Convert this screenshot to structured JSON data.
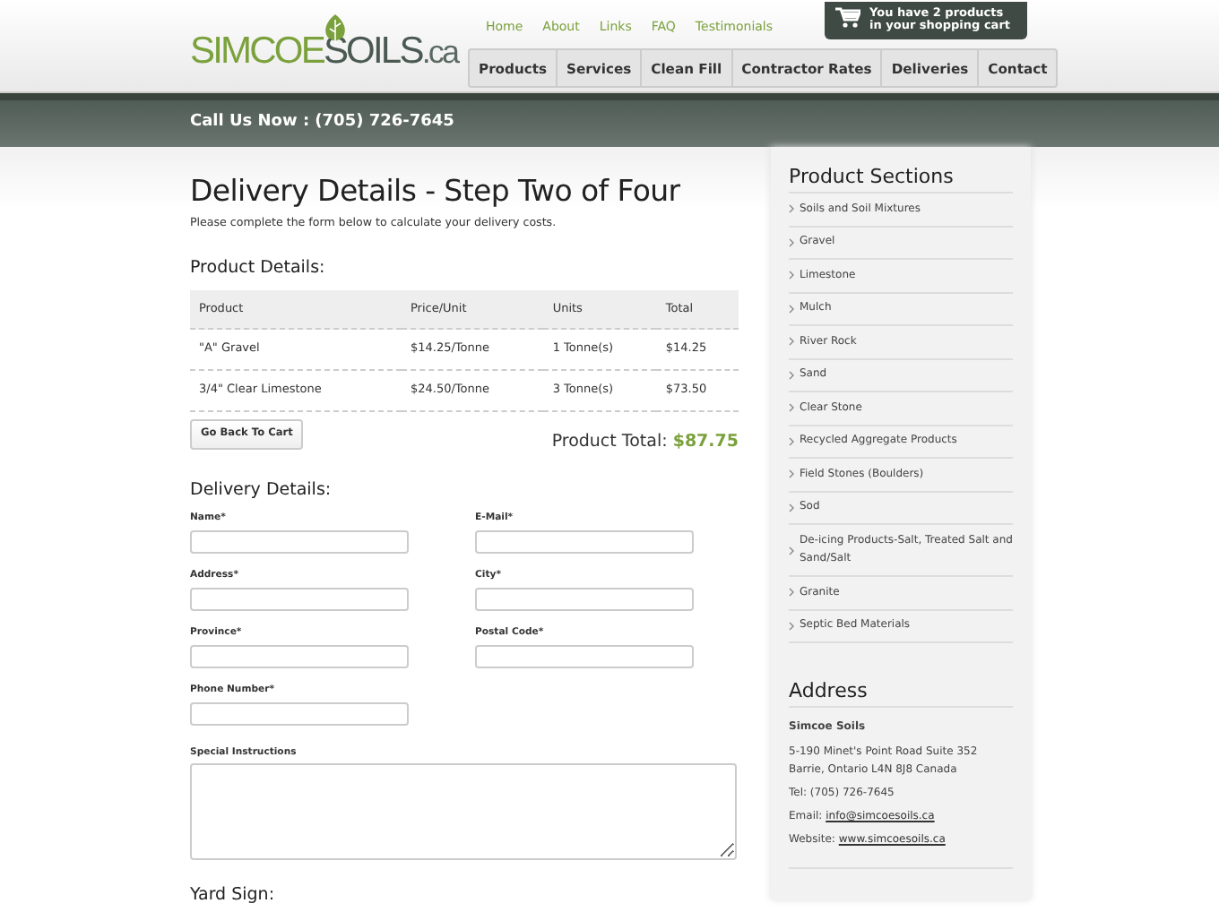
{
  "logo": [
    "SIMCOE",
    "SOILS",
    ".ca"
  ],
  "top_links": [
    "Home",
    "About",
    "Links",
    "FAQ",
    "Testimonials"
  ],
  "cart": [
    "You have 2 products",
    "in your shopping cart"
  ],
  "main_nav": [
    "Products",
    "Services",
    "Clean Fill",
    "Contractor Rates",
    "Deliveries",
    "Contact"
  ],
  "phone_bar": "Call Us Now : (705) 726-7645",
  "title": "Delivery Details - Step Two of Four",
  "intro": "Please complete the form below to calculate your delivery costs.",
  "product_details": {
    "heading": "Product Details:",
    "columns": [
      "Product",
      "Price/Unit",
      "Units",
      "Total"
    ],
    "rows": [
      [
        "\"A\" Gravel",
        "$14.25/Tonne",
        "1 Tonne(s)",
        "$14.25"
      ],
      [
        "3/4\" Clear Limestone",
        "$24.50/Tonne",
        "3 Tonne(s)",
        "$73.50"
      ]
    ],
    "back_button": "Go Back To Cart",
    "total_label": "Product Total:",
    "total_value": "$87.75"
  },
  "delivery_details": {
    "heading": "Delivery Details:",
    "fields": [
      {
        "label": "Name*"
      },
      {
        "label": "E-Mail*"
      },
      {
        "label": "Address*"
      },
      {
        "label": "City*"
      },
      {
        "label": "Province*"
      },
      {
        "label": "Postal Code*"
      },
      {
        "label": "Phone Number*"
      }
    ],
    "instructions_label": "Special Instructions"
  },
  "yard_sign": {
    "heading": "Yard Sign:"
  },
  "sidebar": {
    "heading": "Product Sections",
    "items": [
      "Soils and Soil Mixtures",
      "Gravel",
      "Limestone",
      "Mulch",
      "River Rock",
      "Sand",
      "Clear Stone",
      "Recycled Aggregate Products",
      "Field Stones (Boulders)",
      "Sod",
      "De-icing Products-Salt, Treated Salt and Sand/Salt",
      "Granite",
      "Septic Bed Materials"
    ]
  },
  "address": {
    "heading": "Address",
    "company": "Simcoe Soils",
    "lines": [
      "5-190 Minet's Point Road Suite 352",
      "Barrie, Ontario L4N 8J8 Canada"
    ],
    "tel": "Tel: (705) 726-7645",
    "email": {
      "label": "Email:",
      "link": "info@simcoesoils.ca"
    },
    "website": {
      "label": "Website:",
      "link": "www.simcoesoils.ca"
    }
  }
}
